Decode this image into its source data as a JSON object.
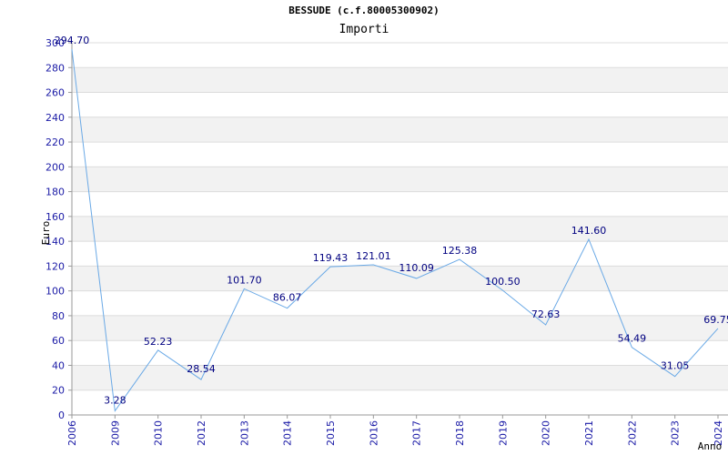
{
  "chart_data": {
    "type": "line",
    "title": "BESSUDE (c.f.80005300902)",
    "subtitle": "Importi",
    "xlabel": "Anno",
    "ylabel": "Euro",
    "ylim": [
      0,
      300
    ],
    "yticks": [
      0,
      20,
      40,
      60,
      80,
      100,
      120,
      140,
      160,
      180,
      200,
      220,
      240,
      260,
      280,
      300
    ],
    "categories": [
      "2006",
      "2009",
      "2010",
      "2012",
      "2013",
      "2014",
      "2015",
      "2016",
      "2017",
      "2018",
      "2019",
      "2020",
      "2021",
      "2022",
      "2023",
      "2024"
    ],
    "values": [
      294.7,
      3.28,
      52.23,
      28.54,
      101.7,
      86.07,
      119.43,
      121.01,
      110.09,
      125.38,
      100.5,
      72.63,
      141.6,
      54.49,
      31.05,
      69.75
    ],
    "value_labels": [
      "294.70",
      "3.28",
      "52.23",
      "28.54",
      "101.70",
      "86.07",
      "119.43",
      "121.01",
      "110.09",
      "125.38",
      "100.50",
      "72.63",
      "141.60",
      "54.49",
      "31.05",
      "69.75"
    ],
    "grid": true,
    "colors": {
      "line": "#6aa9e6",
      "band": "#f2f2f2",
      "tick": "#1a1aa6",
      "label": "#000080"
    }
  }
}
